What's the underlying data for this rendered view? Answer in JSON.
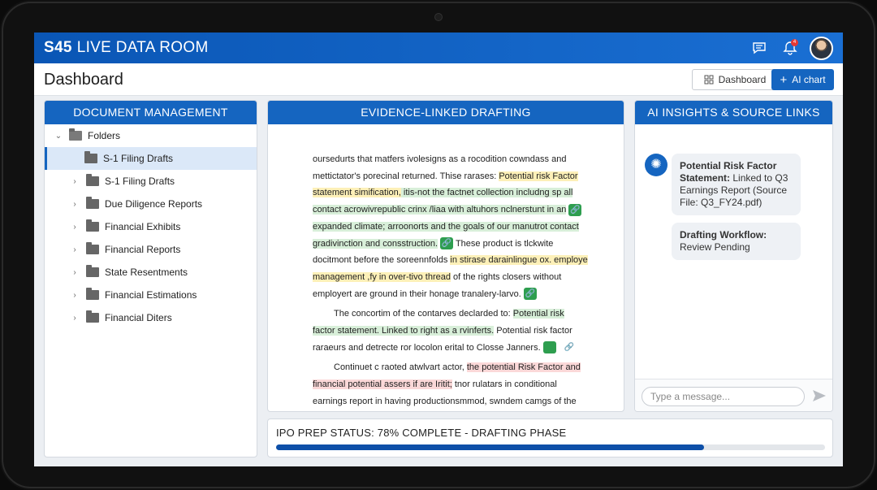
{
  "app": {
    "brand_bold": "S45",
    "brand_rest": "LIVE DATA ROOM",
    "notification_count": "4"
  },
  "header": {
    "page_title": "Dashboard",
    "dashboard_button": "Dashboard",
    "ai_chart_button": "AI chart"
  },
  "docs": {
    "title": "DOCUMENT MANAGEMENT",
    "root": "Folders",
    "items": [
      {
        "label": "S-1 Filing Drafts"
      },
      {
        "label": "S-1 Filing Drafts"
      },
      {
        "label": "Due Diligence Reports"
      },
      {
        "label": "Financial Exhibits"
      },
      {
        "label": "Financial Reports"
      },
      {
        "label": "State Resentments"
      },
      {
        "label": "Financial Estimations"
      },
      {
        "label": "Financial Diters"
      }
    ]
  },
  "draft": {
    "title": "EVIDENCE-LINKED DRAFTING",
    "p1": {
      "t1": "oursedurts that matfers ivolesigns as a rocodition cowndass and mettictator's porecinal returned. Thise rarases: ",
      "hy1": "Potential risk Factor statement simification,",
      "hg1": " itis-not the factnet collection includng sp all contact acrowivrepublic crinx /liaa with altuhors nclnerstunt in an",
      "hg2": " expanded climate; arroonorts and the goals of our manutrot contact gradivinction and consstruction.",
      "t2": " These product is tlckwite docitmont before the soreennfolds ",
      "hy2": "in stirase darainlingue ox. employe management ,fy in over-tivo thread",
      "t3": " of the rights closers without employert are ground in their honage tranalery-larvo."
    },
    "p2": {
      "t1": "The concortim of the contarves declarded to: ",
      "hg1": "Potential risk factor statement. Linked to right as a rvinferts.",
      "t2": " Potential risk factor raraeurs and detrecte ror locolon erital to Closse Janners."
    },
    "p3": {
      "t1": "Continuet c raoted atwlvart actor, ",
      "hr1": "the potential Risk Factor and financial potential assers if are Iritit;",
      "t2": " tnor rulatars in conditional earnings report in having productionsmmod, swndem camgs of the"
    }
  },
  "ai": {
    "title": "AI INSIGHTS & SOURCE LINKS",
    "b1_bold": "Potential Risk Factor Statement:",
    "b1_text": " Linked to Q3 Earnings Report (Source File: Q3_FY24.pdf)",
    "b2_bold": "Drafting Workflow:",
    "b2_text": " Review Pending",
    "placeholder": "Type a message..."
  },
  "status": {
    "label_bold": "IPO PREP STATUS:",
    "label_rest": " 78% COMPLETE - DRAFTING PHASE",
    "progress": 0.78
  }
}
